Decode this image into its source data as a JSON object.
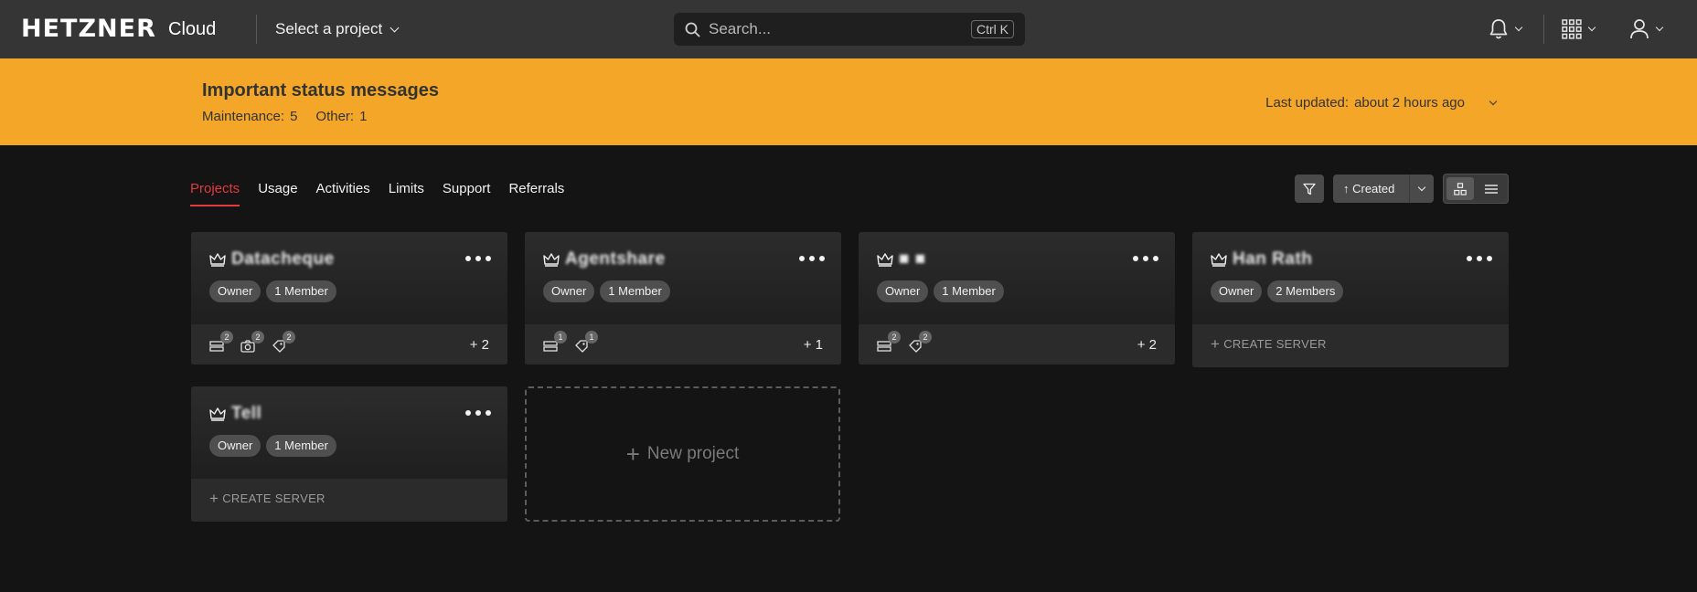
{
  "header": {
    "brand": "HETZNER",
    "product": "Cloud",
    "project_select": "Select a project",
    "search_placeholder": "Search...",
    "search_shortcut": "Ctrl K",
    "icons": [
      "bell-icon",
      "apps-grid-icon",
      "user-icon"
    ]
  },
  "banner": {
    "title": "Important status messages",
    "maintenance_label": "Maintenance:",
    "maintenance_value": "5",
    "other_label": "Other:",
    "other_value": "1",
    "updated_label": "Last updated:",
    "updated_value": "about 2 hours ago",
    "color": "#f3a628"
  },
  "tabs": [
    {
      "label": "Projects",
      "active": true
    },
    {
      "label": "Usage"
    },
    {
      "label": "Activities"
    },
    {
      "label": "Limits"
    },
    {
      "label": "Support"
    },
    {
      "label": "Referrals"
    }
  ],
  "controls": {
    "sort_label": "↑ Created"
  },
  "projects": [
    {
      "name": "Datacheque",
      "role": "Owner",
      "members": "1 Member",
      "resources": [
        {
          "icon": "server-icon",
          "count": "2"
        },
        {
          "icon": "snapshot-icon",
          "count": "2"
        },
        {
          "icon": "floating-ip-icon",
          "count": "2"
        }
      ],
      "more": "+ 2"
    },
    {
      "name": "Agentshare",
      "role": "Owner",
      "members": "1 Member",
      "resources": [
        {
          "icon": "server-icon",
          "count": "1"
        },
        {
          "icon": "floating-ip-icon",
          "count": "1"
        }
      ],
      "more": "+ 1"
    },
    {
      "name": "■ ■",
      "role": "Owner",
      "members": "1 Member",
      "resources": [
        {
          "icon": "server-icon",
          "count": "2"
        },
        {
          "icon": "floating-ip-icon",
          "count": "2"
        }
      ],
      "more": "+ 2"
    },
    {
      "name": "Han Rath",
      "role": "Owner",
      "members": "2 Members",
      "create_label": "CREATE SERVER"
    },
    {
      "name": "Tell",
      "role": "Owner",
      "members": "1 Member",
      "create_label": "CREATE SERVER"
    }
  ],
  "new_project_label": "New project"
}
